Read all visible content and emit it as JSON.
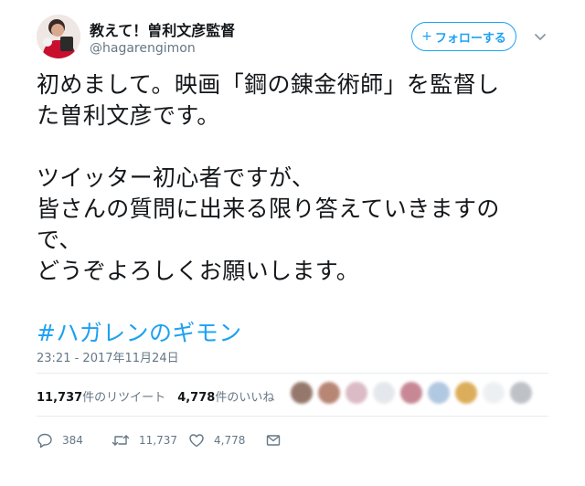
{
  "user": {
    "display_name": "教えて！曽利文彦監督",
    "handle": "@hagarengimon"
  },
  "follow_button": {
    "plus": "+",
    "label": "フォローする"
  },
  "tweet": {
    "lines": [
      "初めまして。映画「鋼の錬金術師」を監督し",
      "た曽利文彦です。",
      "",
      "ツイッター初心者ですが、",
      "皆さんの質問に出来る限り答えていきますの",
      "で、",
      "どうぞよろしくお願いします。",
      ""
    ],
    "hashtag": "#ハガレンのギモン",
    "timestamp": "23:21 - 2017年11月24日"
  },
  "stats": {
    "retweets_count": "11,737",
    "retweets_label": "件のリツイート",
    "likes_count": "4,778",
    "likes_label": "件のいいね"
  },
  "actions": {
    "replies": "384",
    "retweets": "11,737",
    "likes": "4,778"
  },
  "colors": {
    "accent": "#1da1f2",
    "text": "#14171a",
    "muted": "#657786",
    "divider": "#e6ecf0"
  }
}
